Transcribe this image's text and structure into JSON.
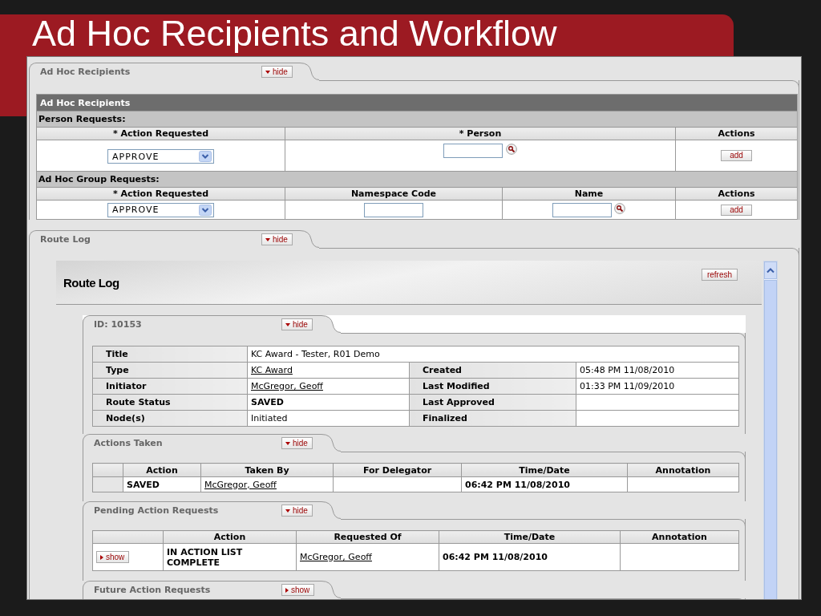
{
  "slide": {
    "title": "Ad Hoc Recipients and Workflow"
  },
  "ad_hoc_tab": {
    "label": "Ad Hoc Recipients",
    "toggle": "hide",
    "expanded": true
  },
  "ad_hoc": {
    "header": "Ad Hoc Recipients",
    "person_requests": {
      "label": "Person Requests:",
      "columns": [
        "* Action Requested",
        "* Person",
        "Actions"
      ],
      "action": "APPROVE",
      "button": "add"
    },
    "group_requests": {
      "label": "Ad Hoc Group Requests:",
      "columns": [
        "* Action Requested",
        "Namespace Code",
        "Name",
        "Actions"
      ],
      "action": "APPROVE",
      "button": "add"
    }
  },
  "route_log_tab": {
    "label": "Route Log",
    "toggle": "hide",
    "expanded": true
  },
  "route_log": {
    "title": "Route Log",
    "refresh": "refresh",
    "document_tab": {
      "label": "ID: 10153",
      "toggle": "hide",
      "expanded": true
    },
    "details": [
      {
        "label": "Title",
        "value": "KC Award - Tester, R01 Demo",
        "kind": "text"
      },
      {
        "label": "Type",
        "value": "KC Award",
        "kind": "link",
        "label_2": "Created",
        "value_2": "05:48 PM 11/08/2010"
      },
      {
        "label": "Initiator",
        "value": "McGregor, Geoff",
        "kind": "link",
        "label_2": "Last Modified",
        "value_2": "01:33 PM 11/09/2010"
      },
      {
        "label": "Route Status",
        "value": "SAVED",
        "kind": "status",
        "label_2": "Last Approved"
      },
      {
        "label": "Node(s)",
        "value": "Initiated",
        "kind": "text",
        "label_2": "Finalized"
      }
    ],
    "actions_taken_tab": {
      "label": "Actions Taken",
      "toggle": "hide",
      "expanded": true
    },
    "actions_taken": {
      "columns": [
        "Action",
        "Taken By",
        "For Delegator",
        "Time/Date",
        "Annotation"
      ],
      "rows": [
        {
          "action": "SAVED",
          "taken_by": "McGregor, Geoff",
          "time": "06:42 PM 11/08/2010"
        }
      ]
    },
    "pending_tab": {
      "label": "Pending Action Requests",
      "toggle": "hide",
      "expanded": true
    },
    "pending": {
      "columns": [
        "Action",
        "Requested Of",
        "Time/Date",
        "Annotation"
      ],
      "rows": [
        {
          "toggle": "show",
          "expanded": false,
          "action": "IN ACTION LIST COMPLETE",
          "requested_of": "McGregor, Geoff",
          "time": "06:42 PM 11/08/2010"
        }
      ]
    },
    "future_tab": {
      "label": "Future Action Requests",
      "toggle": "show",
      "expanded": false
    }
  }
}
